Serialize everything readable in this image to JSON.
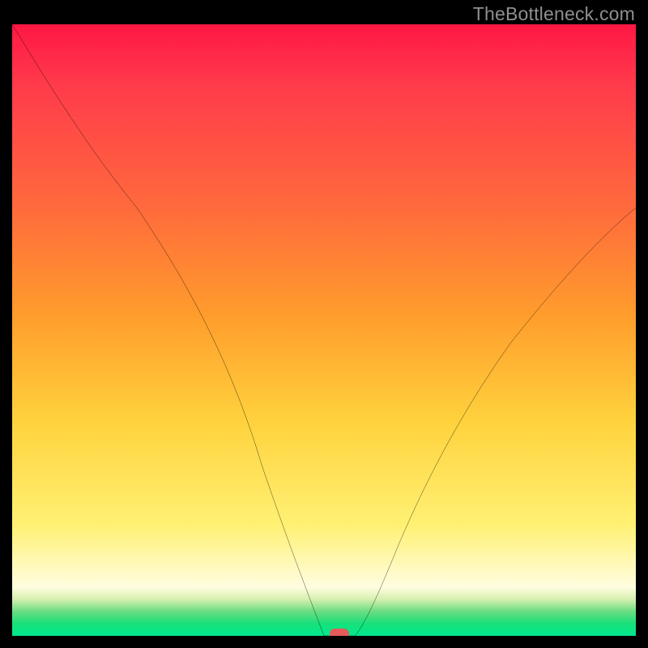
{
  "watermark": "TheBottleneck.com",
  "chart_data": {
    "type": "line",
    "title": "",
    "xlabel": "",
    "ylabel": "",
    "xlim": [
      0,
      100
    ],
    "ylim": [
      0,
      100
    ],
    "grid": false,
    "legend": null,
    "annotations": [],
    "series": [
      {
        "name": "bottleneck-curve",
        "x": [
          0,
          10,
          20,
          30,
          40,
          47,
          50,
          52,
          55,
          57,
          62,
          70,
          80,
          90,
          100
        ],
        "y": [
          100,
          85,
          70,
          55,
          28,
          8,
          0,
          0,
          0,
          4,
          15,
          30,
          48,
          60,
          70
        ]
      }
    ],
    "marker": {
      "x": 52.5,
      "y": 0,
      "color": "#e55a5a"
    },
    "colors": {
      "gradient_top": "#ff1744",
      "gradient_mid": "#ffd23d",
      "gradient_bottom": "#00e88e",
      "curve": "#000000",
      "marker": "#e55a5a",
      "frame": "#000000"
    }
  }
}
